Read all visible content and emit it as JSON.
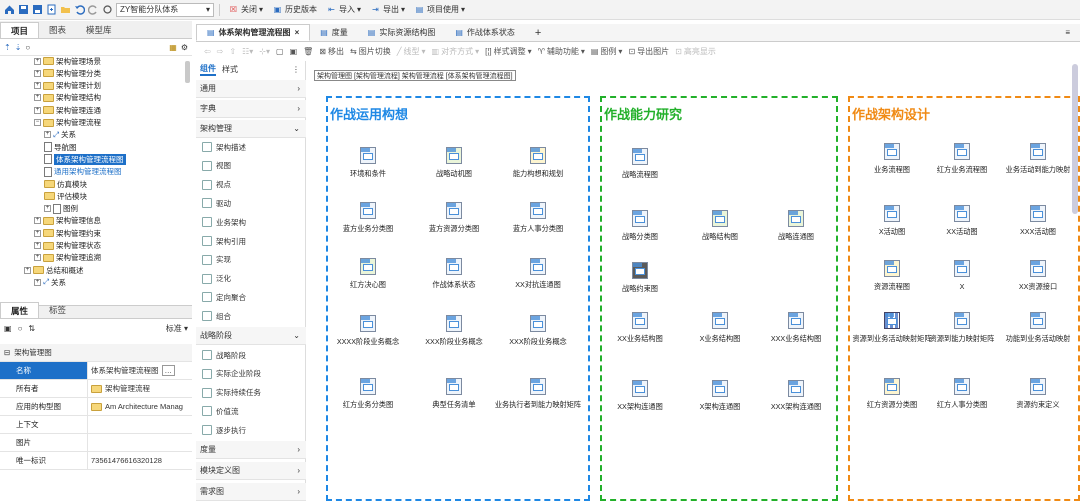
{
  "top_toolbar": {
    "model_combo": "ZY智能分队体系",
    "close": "关闭",
    "history": "历史版本",
    "import": "导入",
    "export": "导出",
    "project_use": "项目使用"
  },
  "left_panel": {
    "tabs": [
      "项目",
      "图表",
      "模型库"
    ],
    "tree": [
      {
        "label": "架构管理场景",
        "level": 3,
        "type": "folder"
      },
      {
        "label": "架构管理分类",
        "level": 3,
        "type": "folder"
      },
      {
        "label": "架构管理计划",
        "level": 3,
        "type": "folder"
      },
      {
        "label": "架构管理结构",
        "level": 3,
        "type": "folder"
      },
      {
        "label": "架构管理连通",
        "level": 3,
        "type": "folder"
      },
      {
        "label": "架构管理流程",
        "level": 3,
        "type": "folder",
        "expanded": true
      },
      {
        "label": "关系",
        "level": 4,
        "type": "relation"
      },
      {
        "label": "导航图",
        "level": 4,
        "type": "doc"
      },
      {
        "label": "体系架构管理流程图",
        "level": 4,
        "type": "doc",
        "selected": true
      },
      {
        "label": "通用架构管理流程图",
        "level": 4,
        "type": "doc",
        "link": true
      },
      {
        "label": "仿真模块",
        "level": 4,
        "type": "box"
      },
      {
        "label": "评估模块",
        "level": 4,
        "type": "box"
      },
      {
        "label": "图例",
        "level": 4,
        "type": "doc"
      },
      {
        "label": "架构管理信息",
        "level": 3,
        "type": "folder"
      },
      {
        "label": "架构管理约束",
        "level": 3,
        "type": "folder"
      },
      {
        "label": "架构管理状态",
        "level": 3,
        "type": "folder"
      },
      {
        "label": "架构管理追溯",
        "level": 3,
        "type": "folder"
      },
      {
        "label": "总结和概述",
        "level": 2,
        "type": "folder"
      },
      {
        "label": "关系",
        "level": 3,
        "type": "relation"
      }
    ]
  },
  "properties": {
    "tabs": [
      "属性",
      "标签"
    ],
    "sort_label": "标准",
    "group": "架构管理图",
    "rows": [
      {
        "key": "名称",
        "value": "体系架构管理流程图"
      },
      {
        "key": "所有者",
        "value": "架构管理流程"
      },
      {
        "key": "应用的构型图",
        "value": "Am Architecture Manag"
      },
      {
        "key": "上下文",
        "value": ""
      },
      {
        "key": "图片",
        "value": ""
      },
      {
        "key": "唯一标识",
        "value": "73561476616320128"
      }
    ]
  },
  "palette": {
    "tabs": [
      "组件",
      "样式"
    ],
    "sections": [
      {
        "label": "通用",
        "expanded": false
      },
      {
        "label": "字典",
        "expanded": false
      },
      {
        "label": "架构管理",
        "expanded": true
      },
      {
        "label": "战略阶段",
        "expanded": true
      },
      {
        "label": "度量",
        "expanded": false
      },
      {
        "label": "模块定义图",
        "expanded": false
      },
      {
        "label": "需求图",
        "expanded": false
      }
    ],
    "items_arch": [
      "架构描述",
      "视图",
      "视点",
      "驱动",
      "业务架构",
      "架构引用",
      "实现",
      "泛化",
      "定向聚合",
      "组合"
    ],
    "items_strategy": [
      "战略阶段",
      "实际企业阶段",
      "实际持续任务",
      "价值流",
      "逐步执行"
    ]
  },
  "doc_tabs": [
    {
      "label": "体系架构管理流程图",
      "active": true
    },
    {
      "label": "度量",
      "active": false
    },
    {
      "label": "实际资源结构图",
      "active": false
    },
    {
      "label": "作战体系状态",
      "active": false
    }
  ],
  "draw_toolbar": {
    "move_out": "移出",
    "image_switch": "图片切换",
    "line_type": "线型",
    "align": "对齐方式",
    "style_adjust": "样式调整",
    "aux_func": "辅助功能",
    "legend": "图例",
    "export_img": "导出图片",
    "hl_display": "高亮显示"
  },
  "breadcrumb": "架构管理图 [架构管理流程] 架构管理流程 [体系架构管理流程图]",
  "lanes": [
    {
      "title": "作战运用构想",
      "color": "#1e88e5",
      "nodes": [
        "环境和条件",
        "战略动机图",
        "能力构想和规划",
        "蓝方业务分类图",
        "蓝方资源分类图",
        "蓝方人事分类图",
        "红方决心图",
        "作战体系状态",
        "XX对抗连通图",
        "XXXX阶段业务概念",
        "XXX阶段业务概念",
        "XXX阶段业务概念",
        "红方业务分类图",
        "典型任务清单",
        "业务执行者到能力映射矩阵"
      ]
    },
    {
      "title": "作战能力研究",
      "color": "#22b02a",
      "nodes": [
        "战略流程图",
        "战略分类图",
        "战略结构图",
        "战略连通图",
        "战略约束图",
        "XX业务结构图",
        "X业务结构图",
        "XXX业务结构图",
        "XX架构连通图",
        "X架构连通图",
        "XXX架构连通图"
      ]
    },
    {
      "title": "作战架构设计",
      "color": "#f08a14",
      "nodes": [
        "业务流程图",
        "红方业务流程图",
        "业务活动到能力映射",
        "X活动图",
        "XX活动图",
        "XXX活动图",
        "资源流程图",
        "X",
        "XX资源接口",
        "资源到业务活动映射矩阵",
        "资源到能力映射矩阵",
        "功能到业务活动映射",
        "红方资源分类图",
        "红方人事分类图",
        "资源约束定义"
      ]
    }
  ]
}
